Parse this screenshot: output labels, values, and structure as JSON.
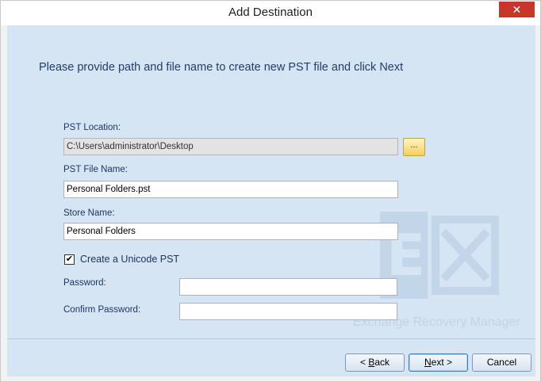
{
  "window": {
    "title": "Add Destination",
    "close_glyph": "✕"
  },
  "heading": "Please provide path and file name to create new PST file and click Next",
  "pst_location": {
    "label": "PST Location:",
    "value": "C:\\Users\\administrator\\Desktop",
    "browse_label": "..."
  },
  "pst_file_name": {
    "label": "PST File Name:",
    "value": "Personal Folders.pst"
  },
  "store_name": {
    "label": "Store Name:",
    "value": "Personal Folders"
  },
  "unicode": {
    "label": "Create a Unicode PST",
    "checked": true,
    "check_glyph": "✔"
  },
  "password": {
    "label": "Password:",
    "value": ""
  },
  "confirm_password": {
    "label": "Confirm Password:",
    "value": ""
  },
  "watermark_text": "Exchange Recovery Manager",
  "buttons": {
    "back_prefix": "< ",
    "back_key": "B",
    "back_rest": "ack",
    "next_key": "N",
    "next_rest": "ext >",
    "cancel": "Cancel"
  },
  "colors": {
    "accent": "#1f3d6e",
    "panel": "#d6e5f4",
    "close": "#c7362b"
  }
}
